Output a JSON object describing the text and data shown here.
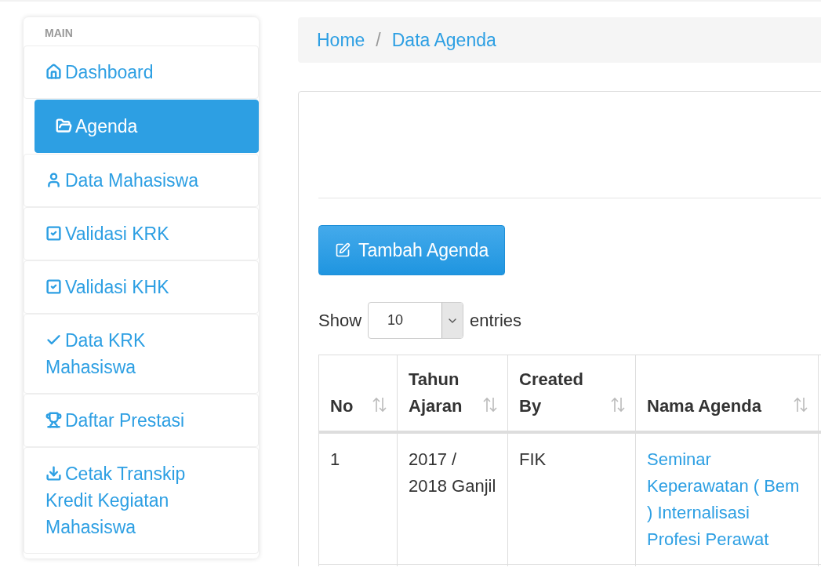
{
  "sidebar": {
    "heading": "MAIN",
    "items": [
      {
        "label": "Dashboard",
        "selected": false
      },
      {
        "label": "Agenda",
        "selected": true
      },
      {
        "label": "Data Mahasiswa",
        "selected": false
      },
      {
        "label": "Validasi KRK",
        "selected": false
      },
      {
        "label": "Validasi KHK",
        "selected": false
      },
      {
        "label": "Data KRK Mahasiswa",
        "selected": false
      },
      {
        "label": "Daftar Prestasi",
        "selected": false
      },
      {
        "label": "Cetak Transkip Kredit Kegiatan Mahasiswa",
        "selected": false
      }
    ]
  },
  "breadcrumb": {
    "separator": "/",
    "items": [
      "Home",
      "Data Agenda"
    ]
  },
  "add_button": "Tambah Agenda",
  "length_menu": {
    "before": "Show",
    "value": "10",
    "after": "entries"
  },
  "table": {
    "columns": [
      {
        "label": "No"
      },
      {
        "label": "Tahun Ajaran"
      },
      {
        "label": "Created By"
      },
      {
        "label": "Nama Agenda"
      }
    ],
    "rows": [
      {
        "cells": [
          "1",
          "2017 / 2018 Ganjil",
          "FIK",
          "Seminar Keperawatan ( Bem ) Internalisasi Profesi Perawat"
        ]
      }
    ]
  }
}
